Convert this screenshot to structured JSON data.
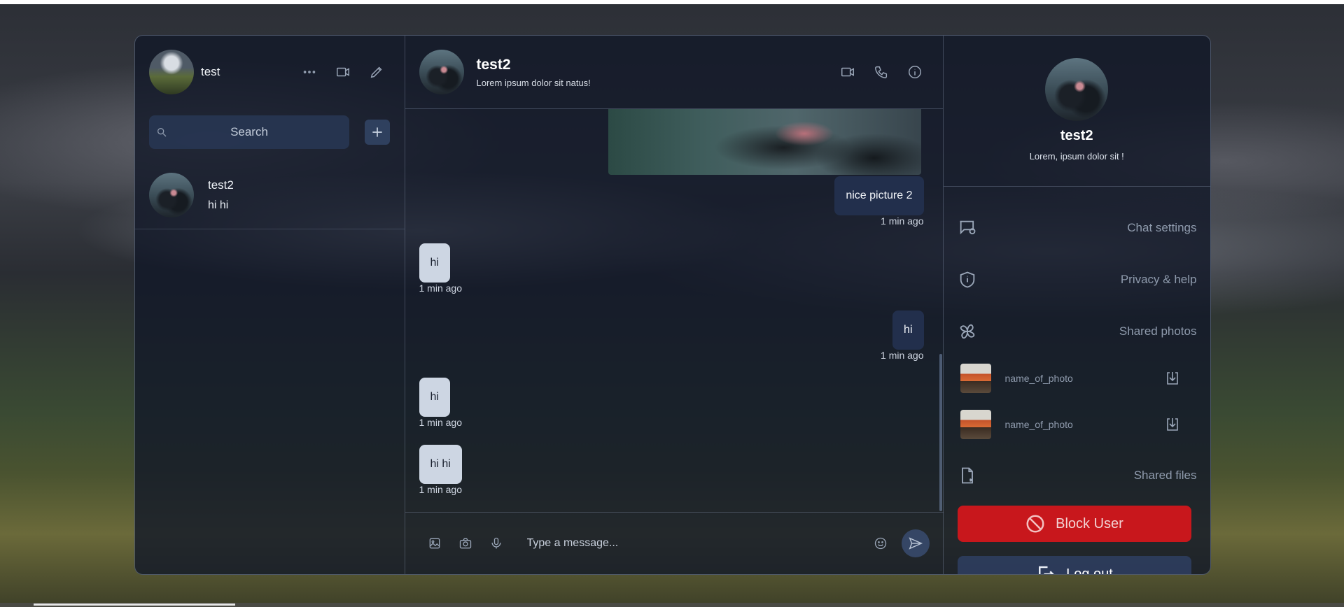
{
  "sidebar": {
    "user_name": "test",
    "search_placeholder": "Search",
    "contacts": [
      {
        "name": "test2",
        "last_message": "hi hi"
      }
    ]
  },
  "chat": {
    "title": "test2",
    "subtitle": "Lorem ipsum dolor sit natus!",
    "messages": [
      {
        "direction": "out",
        "text": "nice picture 2",
        "time": "1 min ago"
      },
      {
        "direction": "in",
        "text": "hi",
        "time": "1 min ago"
      },
      {
        "direction": "out",
        "text": "hi",
        "time": "1 min ago"
      },
      {
        "direction": "in",
        "text": "hi",
        "time": "1 min ago"
      },
      {
        "direction": "in",
        "text": "hi hi",
        "time": "1 min ago"
      }
    ],
    "composer_placeholder": "Type a message..."
  },
  "details": {
    "name": "test2",
    "status": "Lorem, ipsum dolor sit !",
    "options": {
      "chat_settings": "Chat settings",
      "privacy": "Privacy & help",
      "shared_photos": "Shared photos",
      "shared_files": "Shared files"
    },
    "photos": [
      {
        "name": "name_of_photo"
      },
      {
        "name": "name_of_photo"
      }
    ],
    "block_label": "Block User",
    "logout_label": "Log out"
  },
  "colors": {
    "accent_danger": "#c8171c",
    "panel": "#111828",
    "bubble_in": "#cdd6e3",
    "bubble_out": "#23304e"
  }
}
